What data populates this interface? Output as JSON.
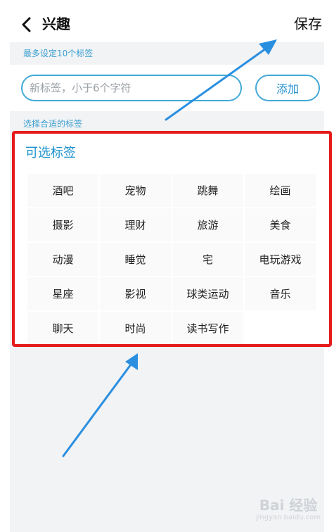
{
  "header": {
    "title": "兴趣",
    "save_label": "保存"
  },
  "hints": {
    "max_tags": "最多设定10个标签",
    "choose_tags": "选择合适的标签"
  },
  "input": {
    "placeholder": "新标签，小于6个字符",
    "value": "",
    "add_label": "添加"
  },
  "panel": {
    "title": "可选标签",
    "tags": [
      "酒吧",
      "宠物",
      "跳舞",
      "绘画",
      "摄影",
      "理财",
      "旅游",
      "美食",
      "动漫",
      "睡觉",
      "宅",
      "电玩游戏",
      "星座",
      "影视",
      "球类运动",
      "音乐",
      "聊天",
      "时尚",
      "读书写作"
    ]
  },
  "annotation": {
    "frame_color": "#e51b1b",
    "arrow_color": "#2b8fe0"
  },
  "watermark": {
    "brand": "Bai 经验",
    "url": "jingyan.baidu.com"
  },
  "colors": {
    "accent": "#1d92cf",
    "border_accent": "#42a9d6",
    "page_bg": "#f2f3f5"
  }
}
